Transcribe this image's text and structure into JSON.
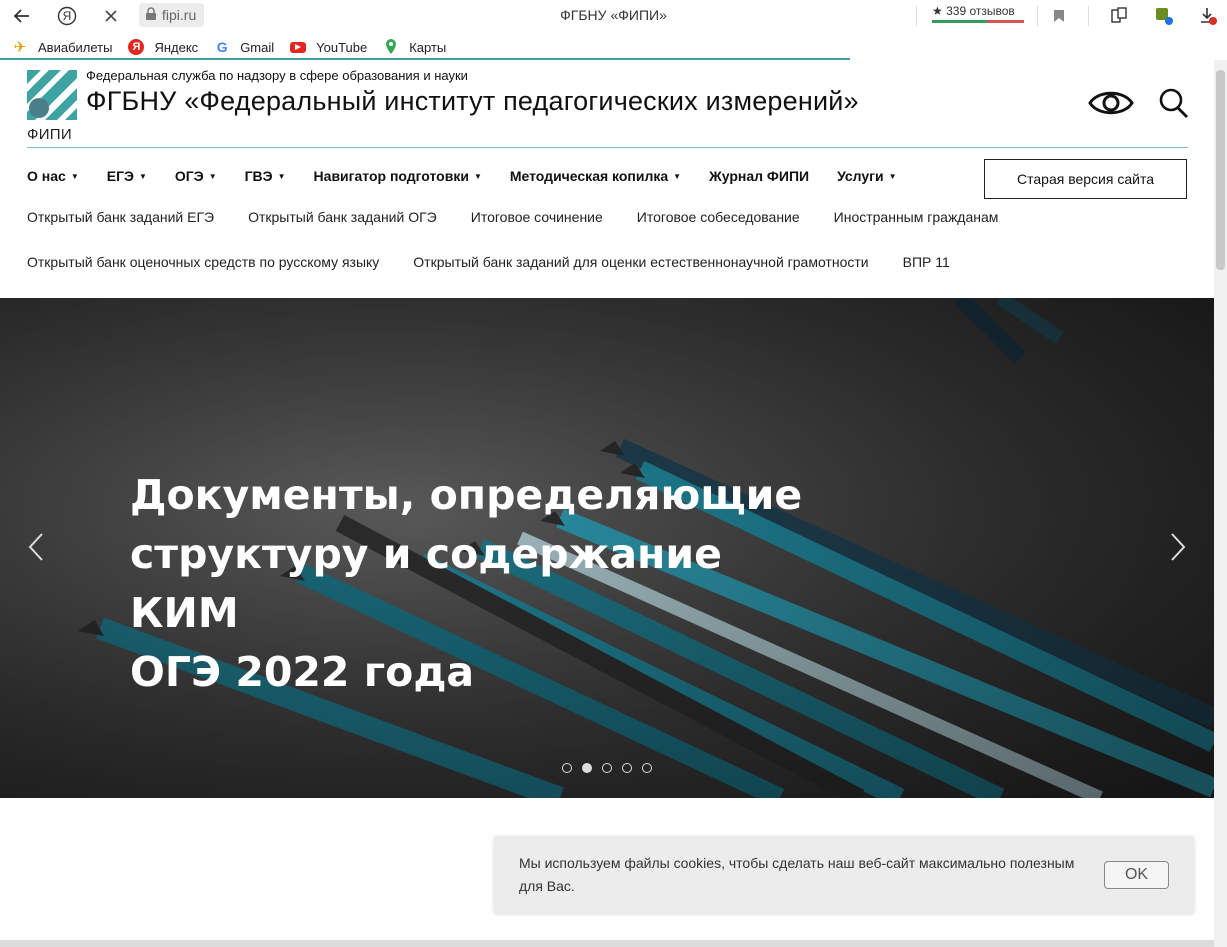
{
  "browser": {
    "url": "fipi.ru",
    "tab_title": "ФГБНУ «ФИПИ»",
    "reviews": "339 отзывов",
    "yandex_letter": "Я"
  },
  "bookmarks": [
    {
      "label": "Авиабилеты",
      "icon": "airplane-icon"
    },
    {
      "label": "Яндекс",
      "icon": "yandex-icon"
    },
    {
      "label": "Gmail",
      "icon": "google-icon"
    },
    {
      "label": "YouTube",
      "icon": "youtube-icon"
    },
    {
      "label": "Карты",
      "icon": "maps-icon"
    }
  ],
  "header": {
    "subtitle": "Федеральная служба по надзору в сфере образования и науки",
    "title": "ФГБНУ «Федеральный институт педагогических измерений»",
    "logo_text": "ФИПИ"
  },
  "nav": {
    "items": [
      {
        "label": "О нас",
        "caret": "▼"
      },
      {
        "label": "ЕГЭ",
        "caret": "▼"
      },
      {
        "label": "ОГЭ",
        "caret": "▼"
      },
      {
        "label": "ГВЭ",
        "caret": "▼"
      },
      {
        "label": "Навигатор подготовки",
        "caret": "▼"
      },
      {
        "label": "Методическая копилка",
        "caret": "▼"
      },
      {
        "label": "Журнал ФИПИ",
        "caret": ""
      },
      {
        "label": "Услуги",
        "caret": "▼"
      }
    ],
    "old_version": "Старая версия сайта"
  },
  "subnav": {
    "row1": [
      "Открытый банк заданий ЕГЭ",
      "Открытый банк заданий ОГЭ",
      "Итоговое сочинение",
      "Итоговое собеседование",
      "Иностранным гражданам"
    ],
    "row2": [
      "Открытый банк оценочных средств по русскому языку",
      "Открытый банк заданий для оценки естественнонаучной грамотности",
      "ВПР 11"
    ]
  },
  "hero": {
    "line1": "Документы, определяющие",
    "line2": "структуру и содержание КИМ",
    "line3": "ОГЭ 2022 года",
    "slide_count": 5,
    "active_slide": 2
  },
  "cookie": {
    "text": "Мы используем файлы cookies, чтобы сделать наш веб-сайт максимально полезным для Вас.",
    "ok": "OK"
  },
  "colors": {
    "teal": "#3fa3a3",
    "pencil": "#1f8296"
  }
}
